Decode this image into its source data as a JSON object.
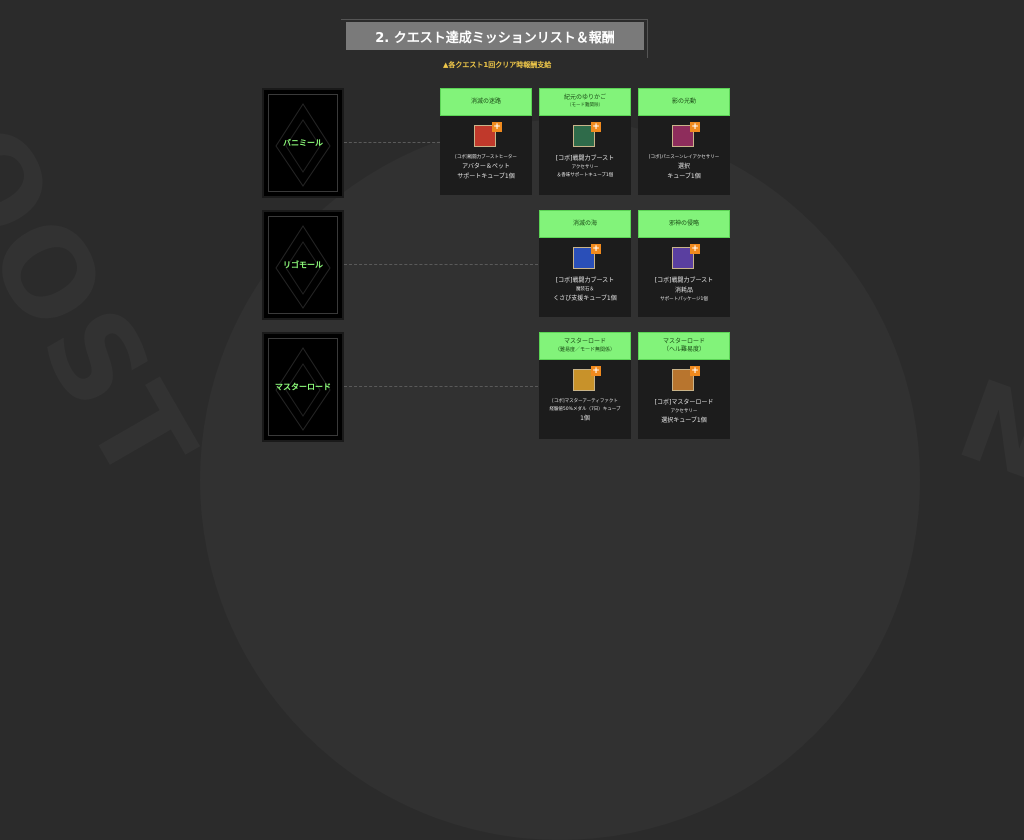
{
  "title": "2. クエスト達成ミッションリスト＆報酬",
  "note": "▲各クエスト1回クリア時報酬支給",
  "bosses": [
    {
      "name": "バニミール"
    },
    {
      "name": "リゴモール"
    },
    {
      "name": "マスターロード"
    }
  ],
  "cards": [
    {
      "head1": "消滅の迷路",
      "head2": "",
      "l1": "[コボ]戦闘力ブーストヒーター",
      "l2": "アバター＆ペット",
      "l3": "サポートキューブ1個",
      "icon_color": "#c0392b"
    },
    {
      "head1": "紀元のゆりかご",
      "head2": "（モード難関除）",
      "l1": "[コボ]戦闘力ブースト",
      "l2": "アクセサリー",
      "l3": "＆香味サポートキューブ1個",
      "icon_color": "#2f6b4a"
    },
    {
      "head1": "影の光動",
      "head2": "",
      "l1": "[コボ]パニスーンレイアクセサリー",
      "l2": "選択",
      "l3": "キューブ1個",
      "icon_color": "#8e2d5c"
    },
    {
      "head1": "消滅の海",
      "head2": "",
      "l1": "[コボ]戦闘力ブースト",
      "l2": "魔装石＆",
      "l3": "くさび支援キューブ1個",
      "icon_color": "#2a4fb8"
    },
    {
      "head1": "邪神の侵略",
      "head2": "",
      "l1": "[コボ]戦闘力ブースト",
      "l2": "消耗品",
      "l3": "サポートパッケージ1個",
      "icon_color": "#5a3fa0"
    },
    {
      "head1": "マスターロード",
      "head2": "（難易度／モード無関係）",
      "l1": "[コボ]マスターアーティファクト",
      "l2": "経験値50%メダル（7日）キューブ",
      "l3": "1個",
      "icon_color": "#c8922a"
    },
    {
      "head1": "マスターロード",
      "head2": "（ヘル難易度）",
      "l1": "[コボ]マスターロード",
      "l2": "アクセサリー",
      "l3": "選択キューブ1個",
      "icon_color": "#b8752e"
    }
  ],
  "plus": "+"
}
